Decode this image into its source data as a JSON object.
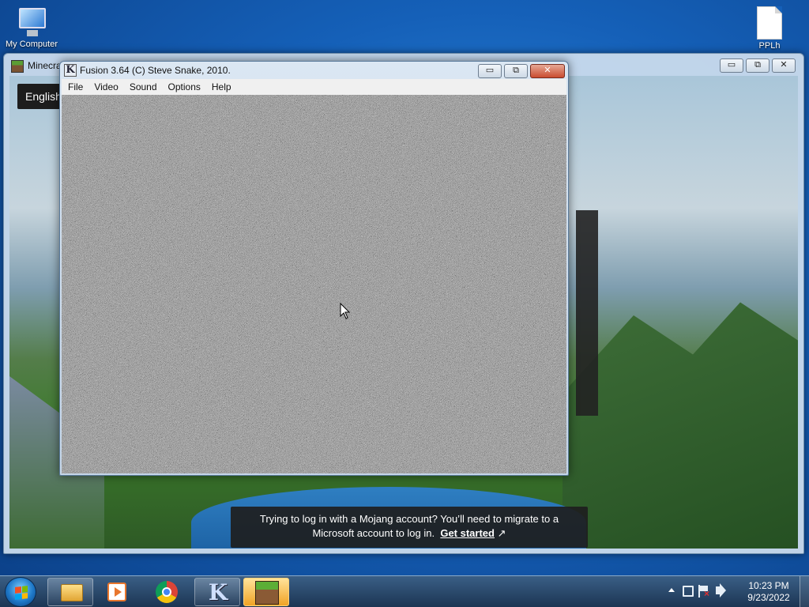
{
  "desktop": {
    "icons": [
      {
        "label": "My Computer",
        "icon": "computer-icon"
      },
      {
        "label": "PPLh",
        "icon": "document-icon"
      }
    ]
  },
  "minecraft_window": {
    "title": "Minecra",
    "language_button": "English",
    "toast": {
      "line1": "Trying to log in with a Mojang account? You’ll need to migrate to a",
      "line2": "Microsoft account to log in.",
      "link": "Get started",
      "link_icon": "external-link-icon"
    },
    "caption_buttons": {
      "minimize": "▭",
      "maximize": "⧉",
      "close": "✕"
    }
  },
  "fusion_window": {
    "title": "Fusion 3.64 (C) Steve Snake, 2010.",
    "app_icon_letter": "K",
    "menu": [
      "File",
      "Video",
      "Sound",
      "Options",
      "Help"
    ],
    "caption_buttons": {
      "minimize": "▭",
      "maximize": "⧉",
      "close": "✕"
    },
    "screen_content": "static-noise"
  },
  "taskbar": {
    "buttons": [
      {
        "name": "Windows Explorer",
        "icon": "folder-icon",
        "state": "pinned"
      },
      {
        "name": "Windows Media Player",
        "icon": "media-player-icon",
        "state": "none"
      },
      {
        "name": "Google Chrome",
        "icon": "chrome-icon",
        "state": "none"
      },
      {
        "name": "Fusion",
        "icon": "fusion-icon",
        "state": "pinned"
      },
      {
        "name": "Minecraft Launcher",
        "icon": "minecraft-icon",
        "state": "active"
      }
    ],
    "clock": {
      "time": "10:23 PM",
      "date": "9/23/2022"
    }
  }
}
